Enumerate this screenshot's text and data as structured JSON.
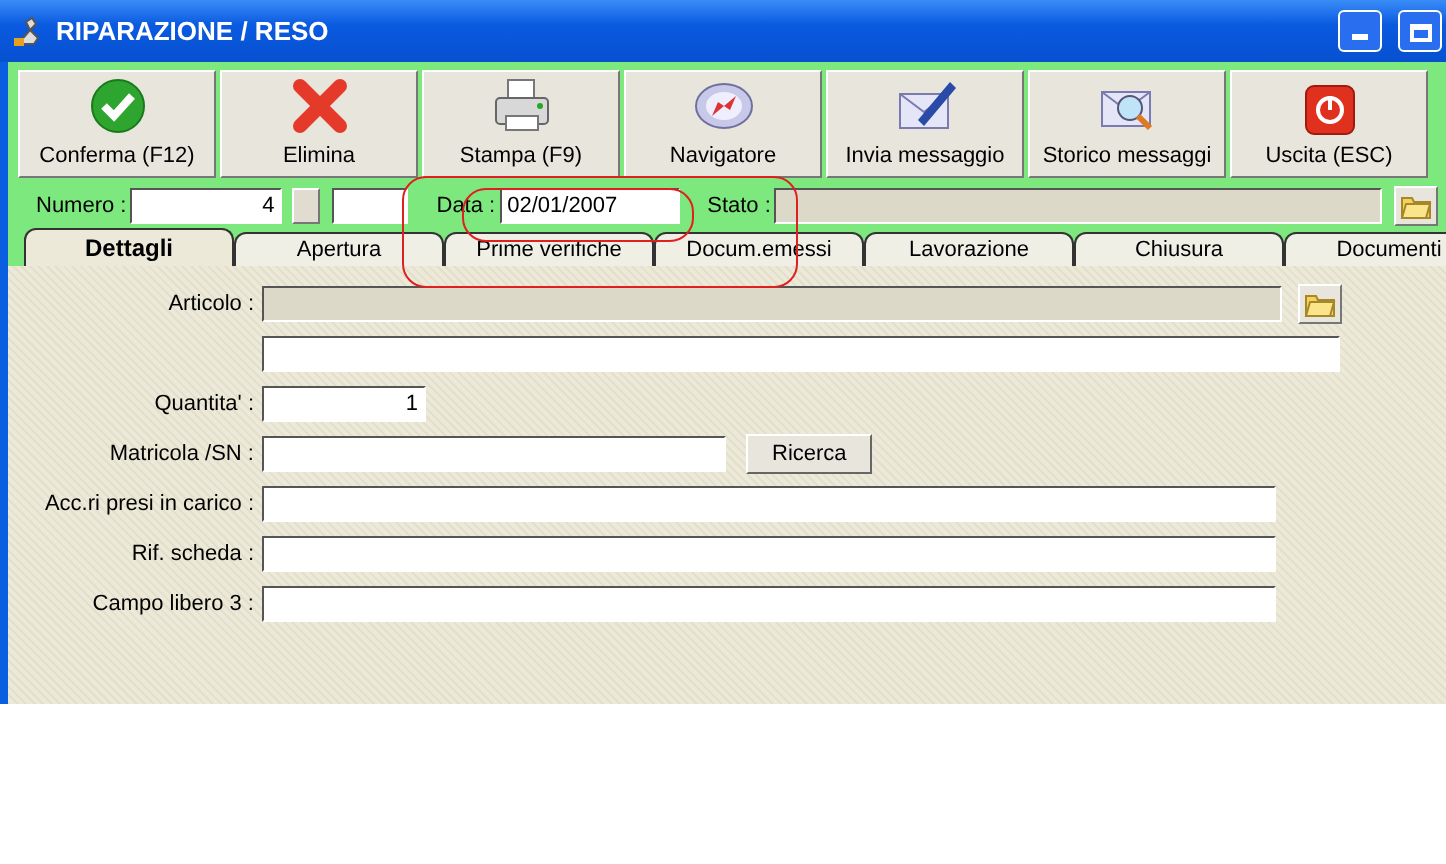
{
  "window": {
    "title": "RIPARAZIONE / RESO"
  },
  "toolbar": [
    {
      "label": "Conferma (F12)"
    },
    {
      "label": "Elimina"
    },
    {
      "label": "Stampa (F9)"
    },
    {
      "label": "Navigatore"
    },
    {
      "label": "Invia messaggio"
    },
    {
      "label": "Storico messaggi"
    },
    {
      "label": "Uscita (ESC)"
    }
  ],
  "header": {
    "numero_label": "Numero :",
    "numero_value": "4",
    "data_label": "Data :",
    "data_value": "02/01/2007",
    "stato_label": "Stato :"
  },
  "tabs": [
    {
      "label": "Dettagli",
      "selected": true
    },
    {
      "label": "Apertura",
      "selected": false
    },
    {
      "label": "Prime verifiche",
      "selected": false
    },
    {
      "label": "Docum.emessi",
      "selected": false
    },
    {
      "label": "Lavorazione",
      "selected": false
    },
    {
      "label": "Chiusura",
      "selected": false
    },
    {
      "label": "Documenti",
      "selected": false
    }
  ],
  "fields": [
    {
      "label": "Articolo :",
      "kind": "folder",
      "disabled": true
    },
    {
      "kind": "plain",
      "disabled": false
    },
    {
      "label": "Quantita' :",
      "kind": "number",
      "value": "1",
      "disabled": false
    },
    {
      "label": "Matricola /SN :",
      "kind": "search",
      "button": "Ricerca",
      "disabled": false
    },
    {
      "label": "Acc.ri presi in carico :",
      "kind": "wide",
      "disabled": false
    },
    {
      "label": "Rif. scheda  :",
      "kind": "wide",
      "disabled": false
    },
    {
      "label": "Campo libero 3 :",
      "kind": "wide",
      "disabled": false
    }
  ]
}
